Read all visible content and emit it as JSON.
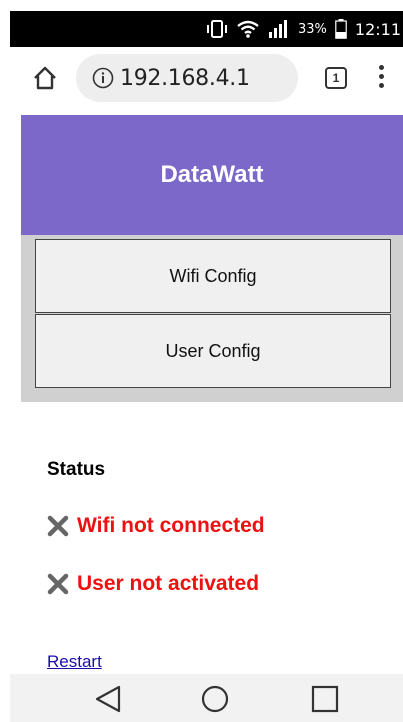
{
  "status_bar": {
    "battery_percent": "33%",
    "time": "12:11"
  },
  "browser": {
    "url": "192.168.4.1",
    "tab_count": "1"
  },
  "page": {
    "header_title": "DataWatt",
    "nav": {
      "wifi_config": "Wifi Config",
      "user_config": "User Config"
    },
    "status": {
      "title": "Status",
      "items": [
        {
          "icon": "cross-icon",
          "text": "Wifi not connected"
        },
        {
          "icon": "cross-icon",
          "text": "User not activated"
        }
      ]
    },
    "restart_link": "Restart"
  },
  "colors": {
    "header_bg": "#7b68c8",
    "error_text": "#ee1111",
    "link": "#1a0dab"
  }
}
